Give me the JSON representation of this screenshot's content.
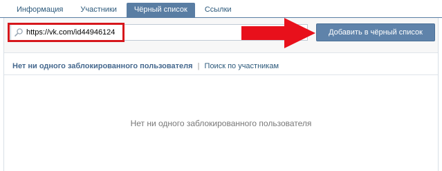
{
  "tabs": [
    {
      "label": "Информация",
      "active": false
    },
    {
      "label": "Участники",
      "active": false
    },
    {
      "label": "Чёрный список",
      "active": true
    },
    {
      "label": "Ссылки",
      "active": false
    }
  ],
  "search": {
    "value": "https://vk.com/id44946124",
    "icon": "search-icon"
  },
  "add_button_label": "Добавить в чёрный список",
  "subnav": {
    "current": "Нет ни одного заблокированного пользователя",
    "separator": "|",
    "link": "Поиск по участникам"
  },
  "empty_message": "Нет ни одного заблокированного пользователя",
  "colors": {
    "accent": "#597da3",
    "link": "#2b587a",
    "annotation": "#d6171c"
  }
}
